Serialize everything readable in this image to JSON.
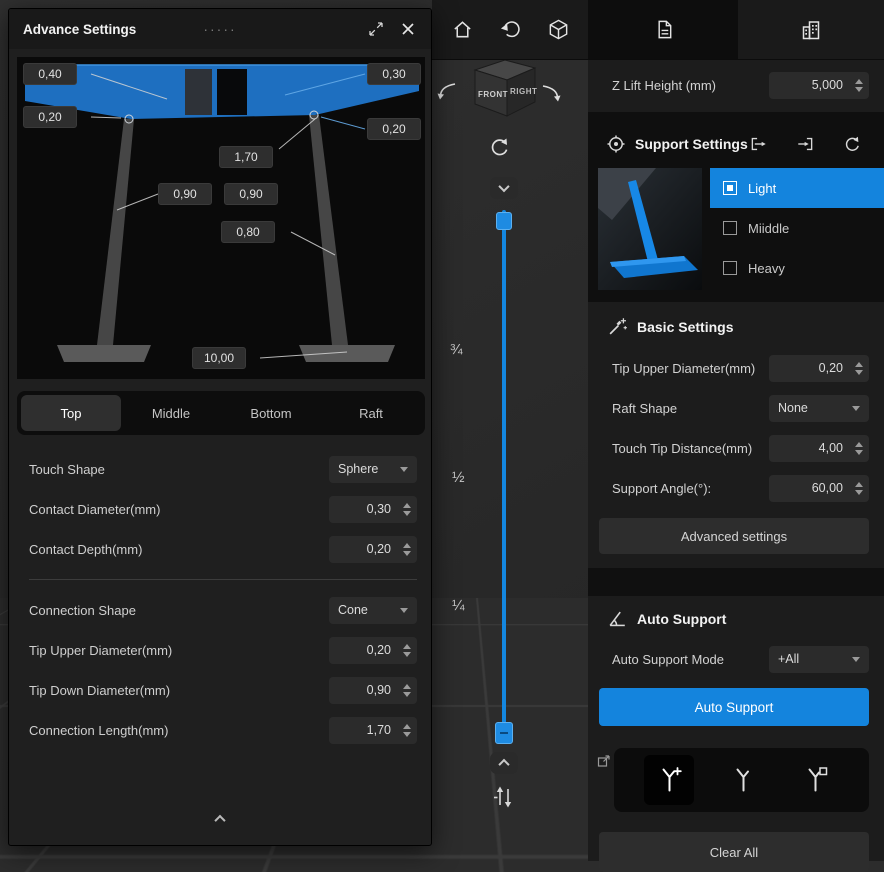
{
  "colors": {
    "accent": "#1484dd",
    "panel_bg": "#1c1c1c",
    "dialog_bg": "#1f1f1f",
    "diagram_bg": "#0a0a0a"
  },
  "dialog": {
    "title": "Advance Settings",
    "drag_handle": "·····",
    "diagram": {
      "labels": {
        "l040": "0,40",
        "l030": "0,30",
        "l020_left": "0,20",
        "l020_right": "0,20",
        "l170": "1,70",
        "l090_a": "0,90",
        "l090_b": "0,90",
        "l080": "0,80",
        "l1000": "10,00"
      }
    },
    "tabs": [
      {
        "label": "Top"
      },
      {
        "label": "Middle"
      },
      {
        "label": "Bottom"
      },
      {
        "label": "Raft"
      }
    ],
    "fields": [
      {
        "label": "Touch Shape",
        "value": "Sphere"
      },
      {
        "label": "Contact Diameter(mm)",
        "value": "0,30"
      },
      {
        "label": "Contact Depth(mm)",
        "value": "0,20"
      },
      {
        "label": "Connection Shape",
        "value": "Cone"
      },
      {
        "label": "Tip Upper Diameter(mm)",
        "value": "0,20"
      },
      {
        "label": "Tip Down Diameter(mm)",
        "value": "0,90"
      },
      {
        "label": "Connection Length(mm)",
        "value": "1,70"
      }
    ]
  },
  "viewport": {
    "cube": {
      "front": "FRONT",
      "right": "RIGHT"
    },
    "slider_ticks": [
      "¾",
      "½",
      "¼"
    ]
  },
  "panel": {
    "z_lift": {
      "label": "Z Lift Height (mm)",
      "value": "5,000"
    },
    "support": {
      "title": "Support Settings",
      "presets": [
        {
          "label": "Light"
        },
        {
          "label": "Miiddle"
        },
        {
          "label": "Heavy"
        }
      ]
    },
    "basic": {
      "title": "Basic Settings",
      "rows": [
        {
          "label": "Tip Upper Diameter(mm)",
          "value": "0,20"
        },
        {
          "label": "Raft Shape",
          "value": "None"
        },
        {
          "label": "Touch Tip Distance(mm)",
          "value": "4,00"
        },
        {
          "label": "Support Angle(°):",
          "value": "60,00"
        }
      ],
      "advanced_button": "Advanced settings"
    },
    "auto": {
      "title": "Auto Support",
      "mode_label": "Auto Support Mode",
      "mode_value": "+All",
      "button": "Auto Support",
      "clear_button": "Clear All"
    }
  }
}
